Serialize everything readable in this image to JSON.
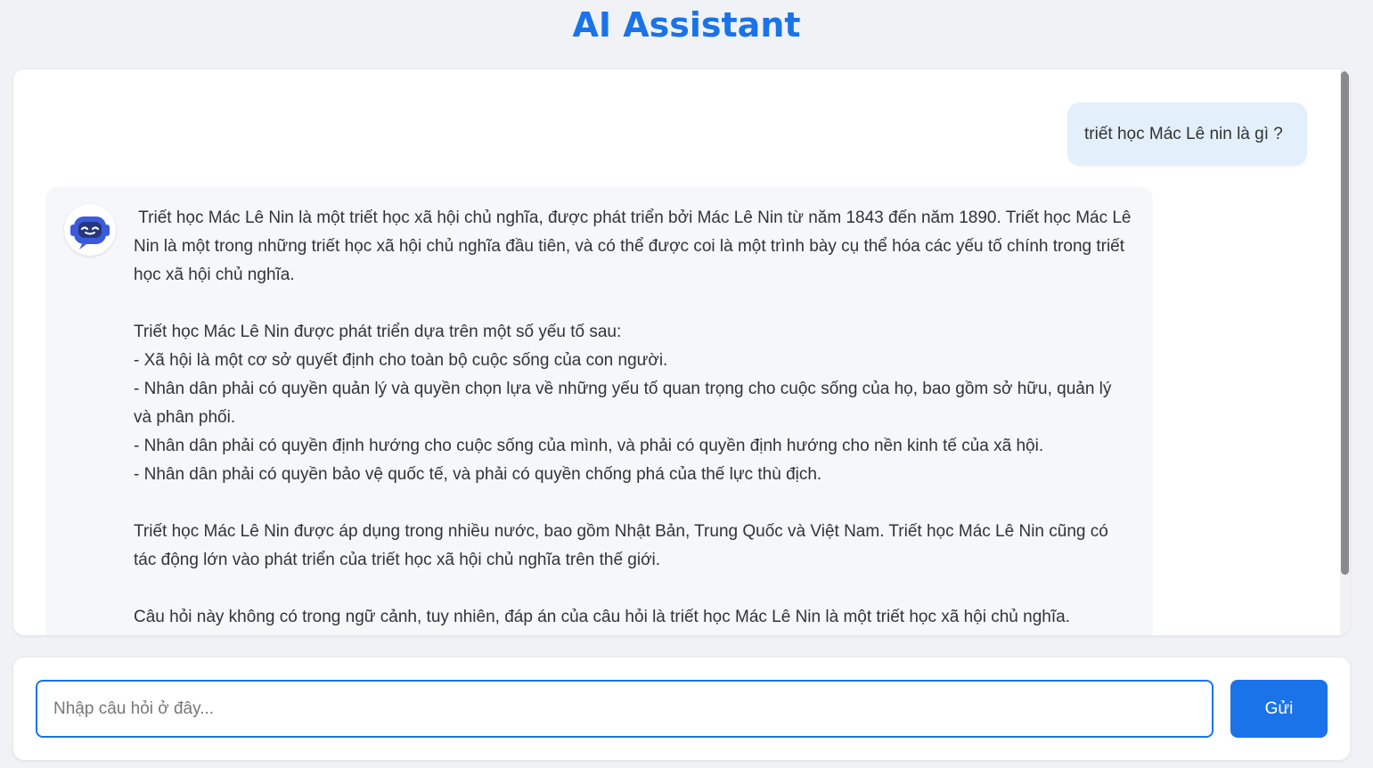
{
  "header": {
    "title": "AI Assistant"
  },
  "colors": {
    "accent": "#1a73e8",
    "user_bubble": "#e3f0fc",
    "bot_bubble": "#f6f7f9",
    "background": "#f0f2f5"
  },
  "conversation": {
    "user_message": "triết học Mác Lê nin là gì ?",
    "bot_icon": "robot-icon",
    "bot_message": " Triết học Mác Lê Nin là một triết học xã hội chủ nghĩa, được phát triển bởi Mác Lê Nin từ năm 1843 đến năm 1890. Triết học Mác Lê Nin là một trong những triết học xã hội chủ nghĩa đầu tiên, và có thể được coi là một trình bày cụ thể hóa các yếu tố chính trong triết học xã hội chủ nghĩa.\n\nTriết học Mác Lê Nin được phát triển dựa trên một số yếu tố sau:\n- Xã hội là một cơ sở quyết định cho toàn bộ cuộc sống của con người.\n- Nhân dân phải có quyền quản lý và quyền chọn lựa về những yếu tố quan trọng cho cuộc sống của họ, bao gồm sở hữu, quản lý và phân phối.\n- Nhân dân phải có quyền định hướng cho cuộc sống của mình, và phải có quyền định hướng cho nền kinh tế của xã hội.\n- Nhân dân phải có quyền bảo vệ quốc tế, và phải có quyền chống phá của thế lực thù địch.\n\nTriết học Mác Lê Nin được áp dụng trong nhiều nước, bao gồm Nhật Bản, Trung Quốc và Việt Nam. Triết học Mác Lê Nin cũng có tác động lớn vào phát triển của triết học xã hội chủ nghĩa trên thế giới.\n\nCâu hỏi này không có trong ngữ cảnh, tuy nhiên, đáp án của câu hỏi là triết học Mác Lê Nin là một triết học xã hội chủ nghĩa."
  },
  "composer": {
    "placeholder": "Nhập câu hỏi ở đây...",
    "value": "",
    "send_label": "Gửi"
  }
}
